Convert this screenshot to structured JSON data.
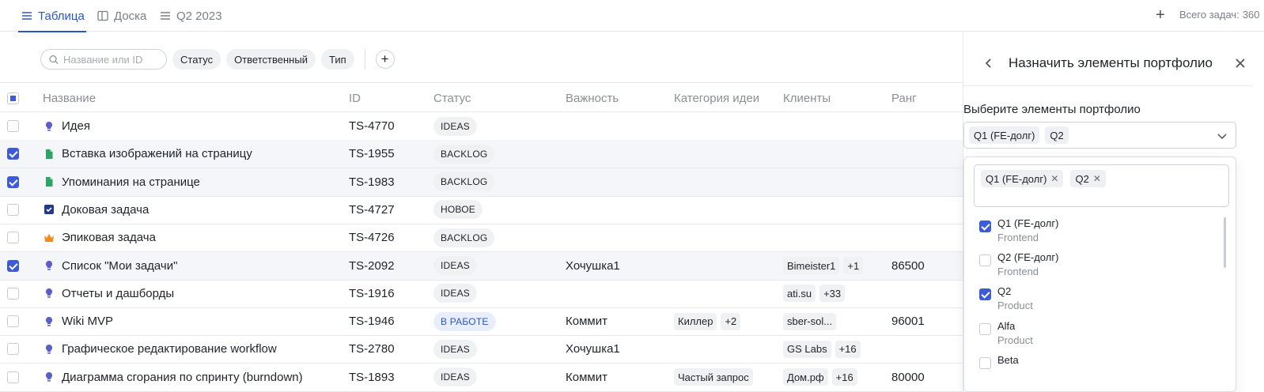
{
  "tabs": [
    {
      "label": "Таблица",
      "icon": "list-icon",
      "active": true
    },
    {
      "label": "Доска",
      "icon": "board-icon",
      "active": false
    },
    {
      "label": "Q2 2023",
      "icon": "list-icon",
      "active": false
    }
  ],
  "header": {
    "total_label": "Всего задач:",
    "total_count": "360"
  },
  "filters": {
    "search_placeholder": "Название или ID",
    "chips": [
      "Статус",
      "Ответственный",
      "Тип"
    ]
  },
  "columns": {
    "name": "Название",
    "id": "ID",
    "status": "Статус",
    "importance": "Важность",
    "category": "Категория идеи",
    "clients": "Клиенты",
    "rank": "Ранг"
  },
  "rows": [
    {
      "name": "Идея",
      "id": "TS-4770",
      "status": "IDEAS",
      "importance": "",
      "category": [],
      "clients": [],
      "rank": "",
      "checked": false,
      "type": "idea"
    },
    {
      "name": "Вставка изображений на страницу",
      "id": "TS-1955",
      "status": "BACKLOG",
      "importance": "",
      "category": [],
      "clients": [],
      "rank": "",
      "checked": true,
      "type": "story"
    },
    {
      "name": "Упоминания на странице",
      "id": "TS-1983",
      "status": "BACKLOG",
      "importance": "",
      "category": [],
      "clients": [],
      "rank": "",
      "checked": true,
      "type": "story"
    },
    {
      "name": "Доковая задача",
      "id": "TS-4727",
      "status": "НОВОЕ",
      "importance": "",
      "category": [],
      "clients": [],
      "rank": "",
      "checked": false,
      "type": "task"
    },
    {
      "name": "Эпиковая задача",
      "id": "TS-4726",
      "status": "BACKLOG",
      "importance": "",
      "category": [],
      "clients": [],
      "rank": "",
      "checked": false,
      "type": "epic"
    },
    {
      "name": "Список \"Мои задачи\"",
      "id": "TS-2092",
      "status": "IDEAS",
      "importance": "Хочушка1",
      "category": [],
      "clients": [
        "Bimeister1",
        "+1"
      ],
      "rank": "86500",
      "checked": true,
      "type": "idea"
    },
    {
      "name": "Отчеты и дашборды",
      "id": "TS-1916",
      "status": "IDEAS",
      "importance": "",
      "category": [],
      "clients": [
        "ati.su",
        "+33"
      ],
      "rank": "",
      "checked": false,
      "type": "idea"
    },
    {
      "name": "Wiki MVP",
      "id": "TS-1946",
      "status": "В РАБОТЕ",
      "importance": "Коммит",
      "category": [
        "Киллер",
        "+2"
      ],
      "clients": [
        "sber-sol...",
        ""
      ],
      "rank": "96001",
      "checked": false,
      "type": "idea"
    },
    {
      "name": "Графическое редактирование workflow",
      "id": "TS-2780",
      "status": "IDEAS",
      "importance": "Хочушка1",
      "category": [],
      "clients": [
        "GS Labs",
        "+16"
      ],
      "rank": "",
      "checked": false,
      "type": "idea"
    },
    {
      "name": "Диаграмма сгорания по спринту (burndown)",
      "id": "TS-1893",
      "status": "IDEAS",
      "importance": "Коммит",
      "category": [
        "Частый запрос",
        ""
      ],
      "clients": [
        "Дом.рф",
        "+16"
      ],
      "rank": "80000",
      "checked": false,
      "type": "idea"
    }
  ],
  "panel": {
    "title": "Назначить элементы портфолио",
    "field_label": "Выберите элементы портфолио",
    "selected": [
      "Q1 (FE-долг)",
      "Q2"
    ],
    "options": [
      {
        "name": "Q1 (FE-долг)",
        "group": "Frontend",
        "checked": true
      },
      {
        "name": "Q2 (FE-долг)",
        "group": "Frontend",
        "checked": false
      },
      {
        "name": "Q2",
        "group": "Product",
        "checked": true
      },
      {
        "name": "Alfa",
        "group": "Product",
        "checked": false
      },
      {
        "name": "Beta",
        "group": "",
        "checked": false
      }
    ]
  },
  "colors": {
    "accent": "#3b5bdb",
    "idea": "#5a5fc8",
    "story": "#2fa366",
    "epic": "#f08c1a",
    "task": "#233a8a"
  }
}
